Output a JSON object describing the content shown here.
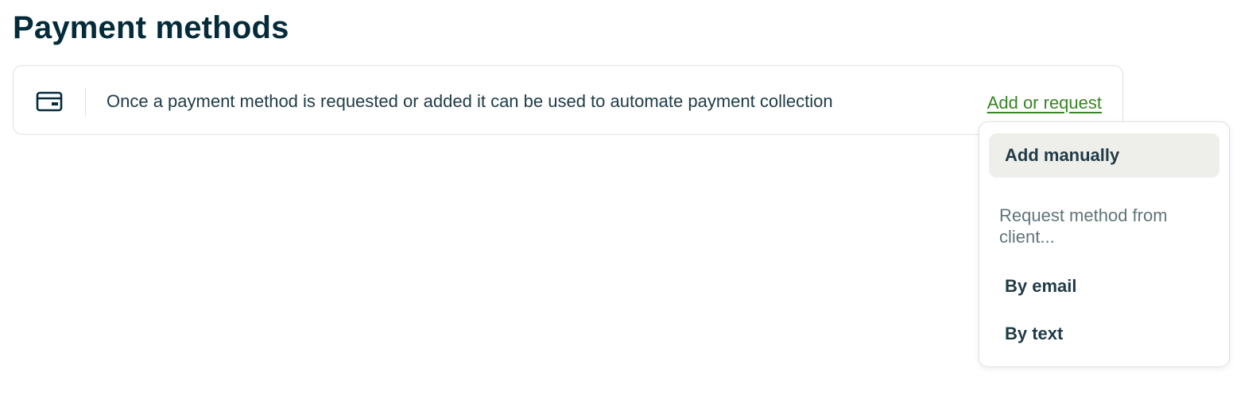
{
  "page": {
    "title": "Payment methods"
  },
  "card": {
    "icon": "credit-card-icon",
    "message": "Once a payment method is requested or added it can be used to automate payment collection",
    "action_label": "Add or request"
  },
  "menu": {
    "items": [
      {
        "label": "Add manually",
        "active": true
      },
      {
        "label": "By email",
        "active": false
      },
      {
        "label": "By text",
        "active": false
      }
    ],
    "group_label": "Request method from client..."
  },
  "colors": {
    "heading": "#032b3a",
    "link": "#388523",
    "muted": "#5f7479",
    "border": "#e1e2de",
    "active_bg": "#eeeeea"
  }
}
